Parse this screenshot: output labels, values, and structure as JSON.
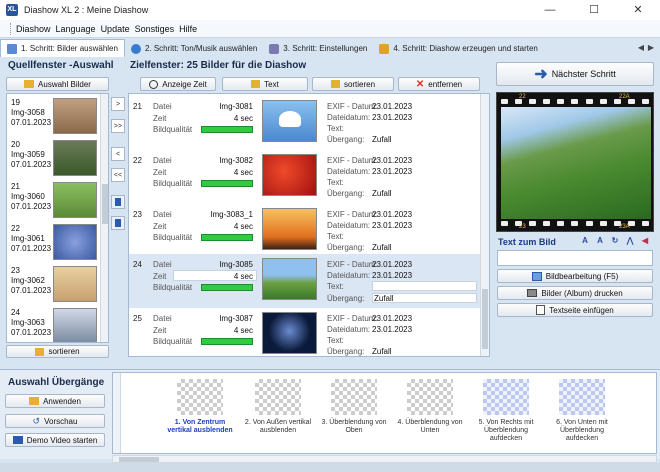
{
  "window": {
    "title": "Diashow XL 2 : Meine Diashow",
    "app_icon": "XL",
    "minimize": "—",
    "maximize": "☐",
    "close": "✕"
  },
  "menu": [
    "Diashow",
    "Language",
    "Update",
    "Sonstiges",
    "Hilfe"
  ],
  "tabs": [
    {
      "label": "1. Schritt: Bilder auswählen",
      "active": true
    },
    {
      "label": "2. Schritt: Ton/Musik auswählen",
      "active": false
    },
    {
      "label": "3. Schritt: Einstellungen",
      "active": false
    },
    {
      "label": "4. Schritt: Diashow erzeugen und starten",
      "active": false
    }
  ],
  "tab_nav": [
    "◀",
    "▶"
  ],
  "source": {
    "title": "Quellfenster -Auswahl",
    "select_button": "Auswahl Bilder",
    "sort_button": "sortieren",
    "items": [
      {
        "label": "19\nImg-3058\n07.01.2023",
        "thumb": "#8a6a4a"
      },
      {
        "label": "20\nImg-3059\n07.01.2023",
        "thumb": "#3a5a2a"
      },
      {
        "label": "21\nImg-3060\n07.01.2023",
        "thumb": "#5c8a3a"
      },
      {
        "label": "22\nImg-3061\n07.01.2023",
        "thumb": "#3a5aa0"
      },
      {
        "label": "23\nImg-3062\n07.01.2023",
        "thumb": "#c8a070"
      },
      {
        "label": "24\nImg-3063\n07.01.2023",
        "thumb": "#7a8aa0"
      }
    ]
  },
  "arrows": [
    ">",
    ">>",
    "<",
    "<<"
  ],
  "target": {
    "title": "Zielfenster: 25 Bilder für die Diashow",
    "toolbar": {
      "time": "Anzeige Zeit",
      "text": "Text",
      "sort": "sortieren",
      "remove": "entfernen"
    },
    "labels": {
      "file": "Datei",
      "time": "Zeit",
      "quality": "Bildqualität",
      "exif": "EXIF - Datum:",
      "filedate": "Dateidatum:",
      "text": "Text:",
      "transition": "Übergang:"
    },
    "rows": [
      {
        "num": "21",
        "file": "Img-3081",
        "time": "4 sec",
        "exif": "23.01.2023",
        "filedate": "23.01.2023",
        "transition": "Zufall",
        "selected": false,
        "thumb_a": "#6aa8e0",
        "thumb_b": "#ffffff"
      },
      {
        "num": "22",
        "file": "Img-3082",
        "time": "4 sec",
        "exif": "23.01.2023",
        "filedate": "23.01.2023",
        "transition": "Zufall",
        "selected": false,
        "thumb_a": "#c82020",
        "thumb_b": "#f04a2a"
      },
      {
        "num": "23",
        "file": "Img-3083_1",
        "time": "4 sec",
        "exif": "23.01.2023",
        "filedate": "23.01.2023",
        "transition": "Zufall",
        "selected": false,
        "thumb_a": "#f0a030",
        "thumb_b": "#402010"
      },
      {
        "num": "24",
        "file": "Img-3085",
        "time": "4 sec",
        "exif": "23.01.2023",
        "filedate": "23.01.2023",
        "transition": "Zufall",
        "selected": true,
        "thumb_a": "#70a8e0",
        "thumb_b": "#5a9a3a"
      },
      {
        "num": "25",
        "file": "Img-3087",
        "time": "4 sec",
        "exif": "23.01.2023",
        "filedate": "23.01.2023",
        "transition": "Zufall",
        "selected": false,
        "thumb_a": "#0a1a3a",
        "thumb_b": "#3a5a9a"
      }
    ]
  },
  "right": {
    "next_button": "Nächster Schritt",
    "film_numbers": [
      "22",
      "22A",
      "23",
      "23A"
    ],
    "text_zum_bild": "Text zum Bild",
    "text_icons": [
      "A",
      "A",
      "↻",
      "⋀",
      "◀"
    ],
    "edit_button": "Bildbearbeitung (F5)",
    "print_button": "Bilder (Album) drucken",
    "textpage_button": "Textseite einfügen"
  },
  "transitions": {
    "title": "Auswahl Übergänge",
    "apply_button": "Anwenden",
    "preview_button": "Vorschau",
    "demo_button": "Demo Video starten",
    "items": [
      {
        "label": "1. Von Zentrum vertikal ausblenden",
        "active": true,
        "blue": false
      },
      {
        "label": "2. Von Außen vertikal ausblenden",
        "active": false,
        "blue": false
      },
      {
        "label": "3. Überblendung von Oben",
        "active": false,
        "blue": false
      },
      {
        "label": "4. Überblendung von Unten",
        "active": false,
        "blue": false
      },
      {
        "label": "5. Von Rechts mit Überblendung aufdecken",
        "active": false,
        "blue": true
      },
      {
        "label": "6. Von Unten mit Überblendung aufdecken",
        "active": false,
        "blue": true
      }
    ]
  },
  "colors": {
    "accent": "#1a3fc0",
    "quality_bar": "#2ecc40",
    "remove_icon": "#e03020"
  }
}
